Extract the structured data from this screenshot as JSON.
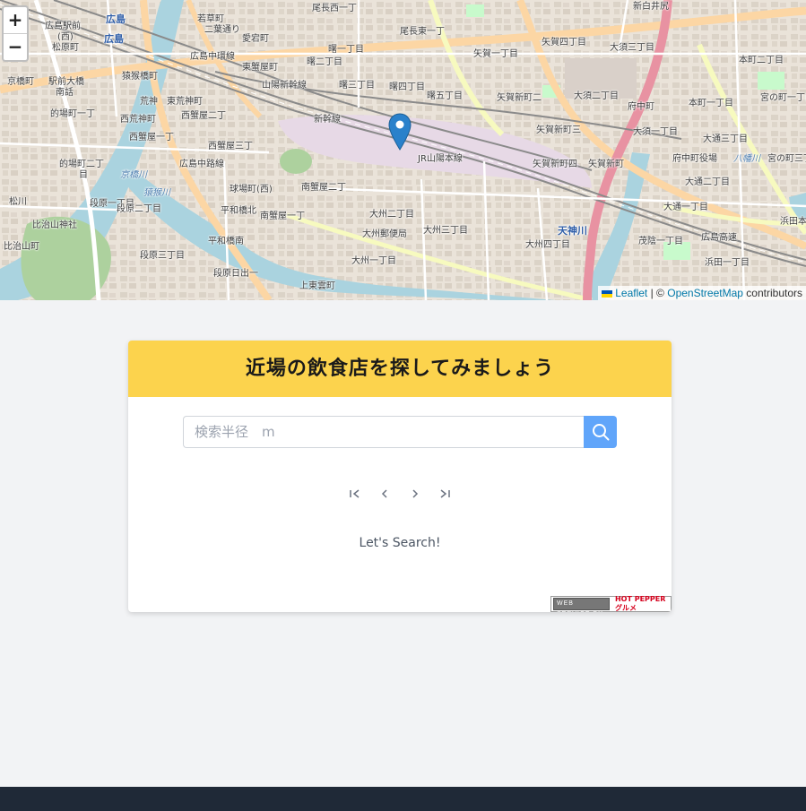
{
  "map": {
    "zoom_in": "+",
    "zoom_out": "−",
    "attribution": {
      "leaflet": "Leaflet",
      "separator": "| ©",
      "osm": "OpenStreetMap",
      "contributors": "contributors"
    },
    "labels": [
      "広島",
      "広島",
      "広島駅前",
      "(西)",
      "松原町",
      "京橋町",
      "駅前大橋",
      "南話",
      "的場町一丁",
      "的場町二丁",
      "目",
      "荒神",
      "東荒神町",
      "西荒神町",
      "西蟹屋一丁",
      "西蟹屋二丁",
      "西蟹屋三丁",
      "広島中環線",
      "猿猴橋町",
      "広島中路線",
      "東蟹屋町",
      "愛宕町",
      "若草町",
      "二葉通り",
      "尾長西一丁",
      "尾長東一丁",
      "曙一丁目",
      "曙二丁目",
      "曙三丁目",
      "曙四丁目",
      "曙五丁目",
      "矢賀一丁目",
      "矢賀四丁目",
      "矢賀新町二",
      "矢賀新町三",
      "矢賀新町四",
      "矢賀新町",
      "大須二丁目",
      "大須三丁目",
      "大須一丁目",
      "山陽新幹線",
      "JR山陽本線",
      "新幹線",
      "球場町(西)",
      "南蟹屋二丁",
      "南蟹屋一丁",
      "平和橋北",
      "平和橋南",
      "大州二丁目",
      "大州一丁目",
      "大州三丁目",
      "大州四丁目",
      "大州郵便局",
      "段原一丁目",
      "段原二丁目",
      "段原三丁目",
      "段原日出一",
      "上東雲町",
      "比治山神社",
      "比治山町",
      "松川",
      "天神川",
      "府中町",
      "本町一丁目",
      "本町二丁目",
      "大通三丁目",
      "大通二丁目",
      "大通一丁目",
      "府中町役場",
      "宮の町一丁目",
      "宮の町三丁目",
      "八幡川",
      "浜田本",
      "浜田一丁目",
      "茂陰一丁目",
      "広島高速",
      "京橋川",
      "猿猴川",
      "新白井尻"
    ]
  },
  "card": {
    "title": "近場の飲食店を探してみましょう",
    "search": {
      "placeholder": "検索半径　m",
      "value": ""
    },
    "pager": [
      "first-page-icon",
      "prev-page-icon",
      "next-page-icon",
      "last-page-icon"
    ],
    "status": "Let's Search!",
    "credit": {
      "ws": "WEB SERVICE BY",
      "brand": "HOT PEPPER グルメ"
    }
  },
  "colors": {
    "header": "#fcd34d",
    "search_button": "#60a5fa",
    "footer": "#1f2937",
    "background": "#f2f3f5",
    "marker": "#2a81cb"
  }
}
